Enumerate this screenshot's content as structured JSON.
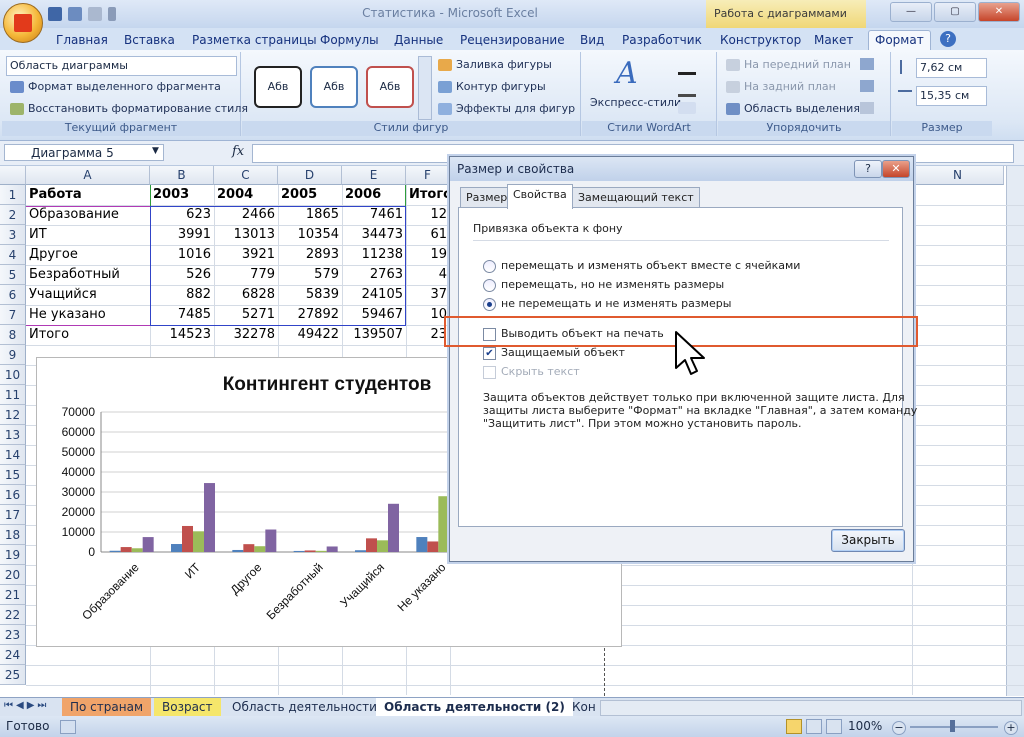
{
  "app": {
    "title": "Статистика - Microsoft Excel",
    "context_tab_header": "Работа с диаграммами"
  },
  "tabs": [
    "Главная",
    "Вставка",
    "Разметка страницы",
    "Формулы",
    "Данные",
    "Рецензирование",
    "Вид",
    "Разработчик",
    "Конструктор",
    "Макет",
    "Формат"
  ],
  "active_tab": "Формат",
  "ribbon": {
    "current_fragment": {
      "combo": "Область диаграммы",
      "format_selection": "Формат выделенного фрагмента",
      "reset_style": "Восстановить форматирование стиля",
      "label": "Текущий фрагмент"
    },
    "shape_styles": {
      "swatch_text": "Абв",
      "swatch_colors": [
        "#222222",
        "#4f81bd",
        "#c0504d"
      ],
      "fill": "Заливка фигуры",
      "outline": "Контур фигуры",
      "effects": "Эффекты для фигур",
      "label": "Стили фигур"
    },
    "wordart": {
      "express": "Экспресс-стили",
      "label": "Стили WordArt"
    },
    "arrange": {
      "bring_front": "На передний план",
      "send_back": "На задний план",
      "selection_pane": "Область выделения",
      "label": "Упорядочить"
    },
    "size": {
      "height": "7,62 см",
      "width": "15,35 см",
      "label": "Размер"
    }
  },
  "formula_bar": {
    "name_box": "Диаграмма 5",
    "fx": "fx"
  },
  "sheet": {
    "columns": [
      "A",
      "B",
      "C",
      "D",
      "E",
      "F",
      "N"
    ],
    "rows": [
      "1",
      "2",
      "3",
      "4",
      "5",
      "6",
      "7",
      "8",
      "9",
      "10",
      "11",
      "12",
      "13",
      "14",
      "15",
      "16",
      "17",
      "18",
      "19",
      "20",
      "21",
      "22",
      "23",
      "24",
      "25"
    ],
    "header_row": [
      "Работа",
      "2003",
      "2004",
      "2005",
      "2006",
      "Итого"
    ],
    "data": [
      {
        "name": "Образование",
        "v": [
          "623",
          "2466",
          "1865",
          "7461",
          "12"
        ]
      },
      {
        "name": "ИТ",
        "v": [
          "3991",
          "13013",
          "10354",
          "34473",
          "61"
        ]
      },
      {
        "name": "Другое",
        "v": [
          "1016",
          "3921",
          "2893",
          "11238",
          "19"
        ]
      },
      {
        "name": "Безработный",
        "v": [
          "526",
          "779",
          "579",
          "2763",
          "4"
        ]
      },
      {
        "name": "Учащийся",
        "v": [
          "882",
          "6828",
          "5839",
          "24105",
          "37"
        ]
      },
      {
        "name": "Не указано",
        "v": [
          "7485",
          "5271",
          "27892",
          "59467",
          "10"
        ]
      }
    ],
    "total_row": {
      "name": "Итого",
      "v": [
        "14523",
        "32278",
        "49422",
        "139507",
        "23"
      ]
    }
  },
  "chart_data": {
    "type": "bar",
    "title": "Контингент студентов",
    "categories": [
      "Образование",
      "ИТ",
      "Другое",
      "Безработный",
      "Учащийся",
      "Не указано"
    ],
    "series": [
      {
        "values": [
          623,
          3991,
          1016,
          526,
          882,
          7485
        ],
        "color": "#4f81bd"
      },
      {
        "values": [
          2466,
          13013,
          3921,
          779,
          6828,
          5271
        ],
        "color": "#c0504d"
      },
      {
        "values": [
          1865,
          10354,
          2893,
          579,
          5839,
          27892
        ],
        "color": "#9bbb59"
      },
      {
        "values": [
          7461,
          34473,
          11238,
          2763,
          24105,
          59467
        ],
        "color": "#8064a2"
      }
    ],
    "y_ticks": [
      "70000",
      "60000",
      "50000",
      "40000",
      "30000",
      "20000",
      "10000",
      "0"
    ],
    "ylim": [
      0,
      70000
    ],
    "grid": true
  },
  "dialog": {
    "title": "Размер и свойства",
    "help": "?",
    "close_x": "✕",
    "tabs": [
      "Размер",
      "Свойства",
      "Замещающий текст"
    ],
    "active_tab": "Свойства",
    "anchor_label": "Привязка объекта к фону",
    "radio": [
      {
        "label": "перемещать и изменять объект вместе с ячейками",
        "checked": false
      },
      {
        "label": "перемещать, но не изменять размеры",
        "checked": false
      },
      {
        "label": "не перемещать и не изменять размеры",
        "checked": true
      }
    ],
    "print_object": "Выводить объект на печать",
    "locked": "Защищаемый объект",
    "hide_text": "Скрыть текст",
    "note_1": "Защита объектов действует только при включенной защите листа. Для",
    "note_2": "защиты листа выберите \"Формат\" на вкладке \"Главная\", а затем команду",
    "note_3": "\"Защитить лист\". При этом можно установить пароль.",
    "close_button": "Закрыть"
  },
  "sheet_tabs": [
    "По странам",
    "Возраст",
    "Область деятельности",
    "Область деятельности (2)",
    "Кон"
  ],
  "active_sheet": "Область деятельности (2)",
  "status": {
    "ready": "Готово",
    "zoom": "100%"
  }
}
